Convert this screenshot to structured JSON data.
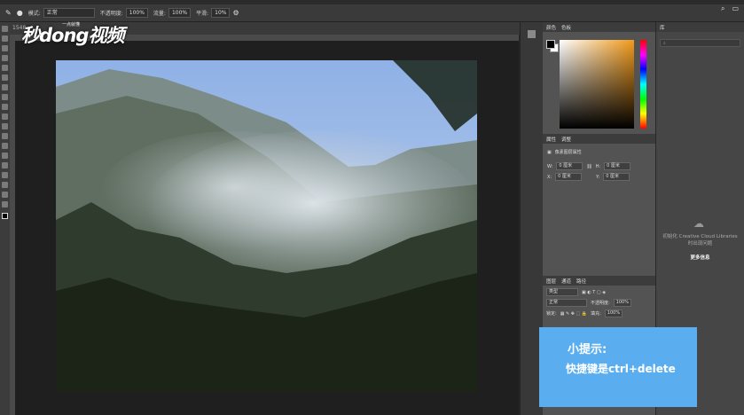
{
  "options_bar": {
    "mode_label": "模式:",
    "mode_value": "正常",
    "opacity_label": "不透明度:",
    "opacity_value": "100%",
    "flow_label": "流量:",
    "flow_value": "100%",
    "smooth_label": "平滑:",
    "smooth_value": "10%"
  },
  "document": {
    "tab_title": "1548"
  },
  "watermark": {
    "brand": "秒dong视频",
    "sub": "一点就懂"
  },
  "panels": {
    "color_tabs": [
      "颜色",
      "色板"
    ],
    "properties_tabs": [
      "属性",
      "调整"
    ],
    "properties_title": "像素图层属性",
    "w_label": "W:",
    "w_value": "0 厘米",
    "h_label": "H:",
    "h_value": "0 厘米",
    "x_label": "X:",
    "x_value": "0 厘米",
    "y_label": "Y:",
    "y_value": "0 厘米",
    "layers_tabs": [
      "图层",
      "通道",
      "路径"
    ],
    "kind_label": "类型",
    "blend_value": "正常",
    "layer_opacity_label": "不透明度:",
    "layer_opacity_value": "100%",
    "lock_label": "锁定:",
    "fill_label": "填充:",
    "fill_value": "100%"
  },
  "libraries": {
    "tab": "库",
    "message": "初始化 Creative Cloud Libraries 时出现问题",
    "link": "更多信息"
  },
  "tip": {
    "title": "小提示:",
    "body": "快捷键是ctrl+delete"
  },
  "colors": {
    "tip_bg": "#5aaef0",
    "panel_bg": "#535353",
    "canvas_bg": "#1f1f1f"
  }
}
